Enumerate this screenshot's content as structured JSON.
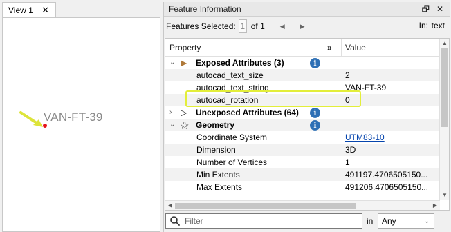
{
  "view": {
    "tab_label": "View 1",
    "close_glyph": "✕",
    "feature_label": "VAN-FT-39",
    "arrow_color": "#dde43a",
    "point_color": "#e6141a"
  },
  "panel": {
    "title": "Feature Information",
    "float_glyph": "🗗",
    "close_glyph": "✕",
    "features_selected_label": "Features Selected:",
    "selected_index": "1",
    "of_label": "of 1",
    "in_label": "In:",
    "in_value": "text",
    "prev_glyph": "◀",
    "next_glyph": "▶"
  },
  "table": {
    "headers": {
      "property": "Property",
      "expand": "»",
      "value": "Value"
    },
    "rows": [
      {
        "kind": "group",
        "expander": "⌄",
        "icon": "▶",
        "icon_name": "exposed-attrs-icon",
        "property": "Exposed Attributes (3)",
        "info": "i",
        "value": ""
      },
      {
        "kind": "child",
        "property": "autocad_text_size",
        "value": "2"
      },
      {
        "kind": "child",
        "property": "autocad_text_string",
        "value": "VAN-FT-39"
      },
      {
        "kind": "child",
        "property": "autocad_rotation",
        "value": "0"
      },
      {
        "kind": "group",
        "expander": "›",
        "icon": "▷",
        "icon_name": "unexposed-attrs-icon",
        "property": "Unexposed Attributes (64)",
        "info": "i",
        "value": ""
      },
      {
        "kind": "group",
        "expander": "⌄",
        "icon": "⚝",
        "icon_name": "geometry-icon",
        "property": "Geometry",
        "info": "i",
        "value": ""
      },
      {
        "kind": "child",
        "property": "Coordinate System",
        "value": "UTM83-10",
        "link": true
      },
      {
        "kind": "child",
        "property": "Dimension",
        "value": "3D"
      },
      {
        "kind": "child",
        "property": "Number of Vertices",
        "value": "1"
      },
      {
        "kind": "child",
        "property": "Min Extents",
        "value": "491197.4706505150..."
      },
      {
        "kind": "child",
        "property": "Max Extents",
        "value": "491206.4706505150..."
      }
    ],
    "highlight_color": "#e3ee3a",
    "link_color": "#0645ad",
    "info_color": "#2d6fb5"
  },
  "filter": {
    "placeholder": "Filter",
    "in_label": "in",
    "scope_value": "Any",
    "chevron": "⌄"
  }
}
